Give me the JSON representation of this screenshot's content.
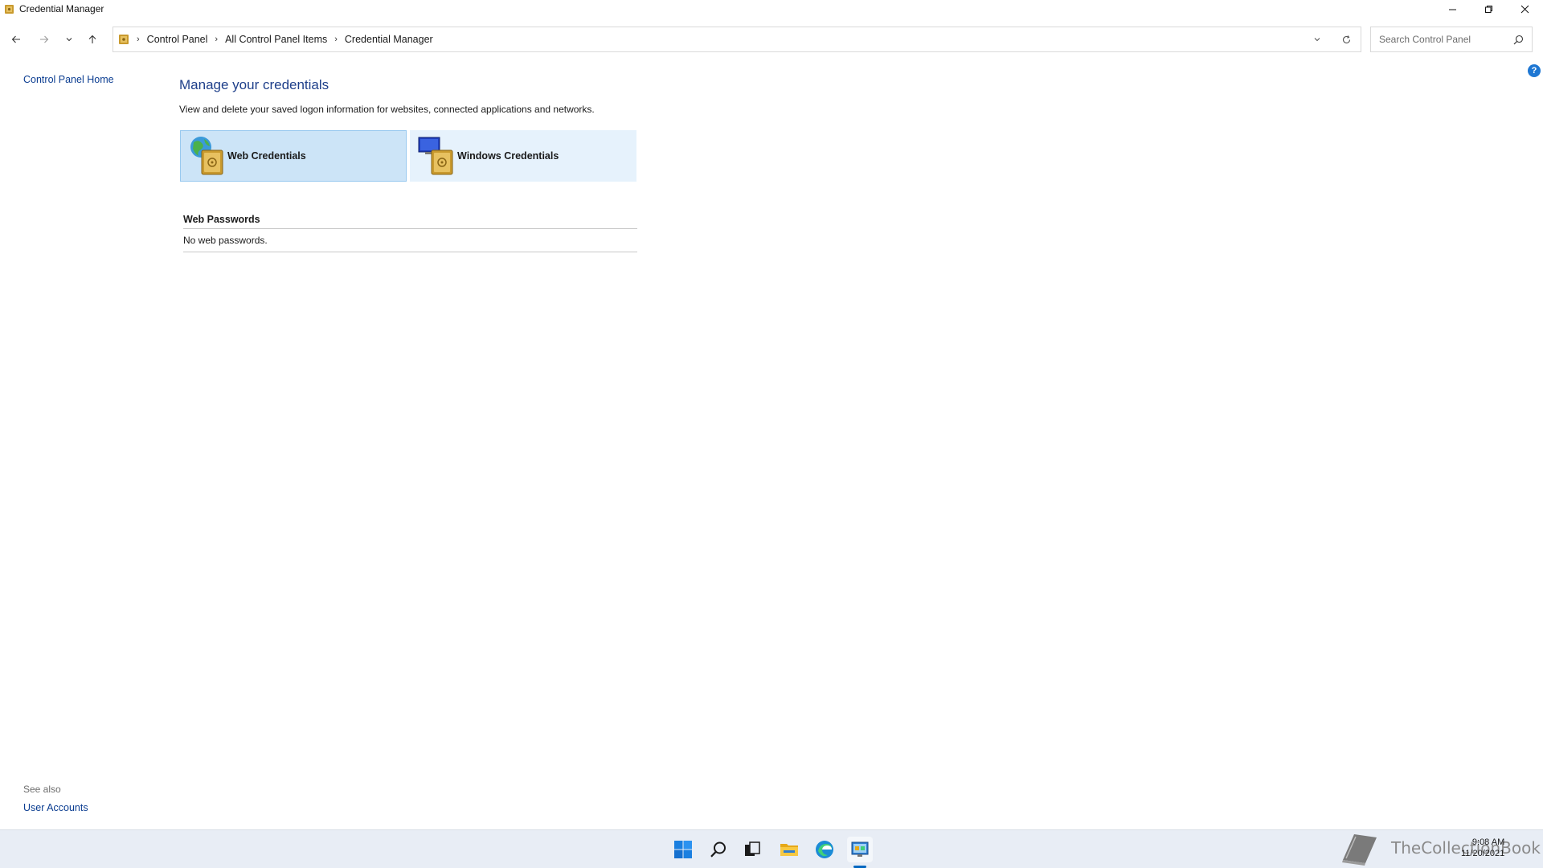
{
  "window": {
    "title": "Credential Manager"
  },
  "address": {
    "breadcrumbs": [
      "Control Panel",
      "All Control Panel Items",
      "Credential Manager"
    ],
    "search_placeholder": "Search Control Panel"
  },
  "sidebar": {
    "home_link": "Control Panel Home",
    "see_also_label": "See also",
    "see_also_links": [
      "User Accounts"
    ]
  },
  "main": {
    "title": "Manage your credentials",
    "description": "View and delete your saved logon information for websites, connected applications and networks.",
    "tiles": [
      {
        "label": "Web Credentials",
        "icon": "web-credentials-icon",
        "selected": true
      },
      {
        "label": "Windows Credentials",
        "icon": "windows-credentials-icon",
        "selected": false
      }
    ],
    "section": {
      "title": "Web Passwords",
      "empty_text": "No web passwords."
    }
  },
  "taskbar": {
    "apps": [
      "start-icon",
      "search-icon",
      "task-view-icon",
      "file-explorer-icon",
      "edge-icon",
      "control-panel-icon"
    ],
    "active_app": "control-panel-icon",
    "watermark": "TheCollectionBook",
    "time": "9:08 AM",
    "date": "11/20/2021"
  },
  "colors": {
    "link": "#0b3d91",
    "title": "#1e3f8a",
    "tile_selected": "#cce4f7",
    "tile": "#e6f2fc",
    "taskbar": "#e8edf5",
    "accent": "#0067c0"
  }
}
